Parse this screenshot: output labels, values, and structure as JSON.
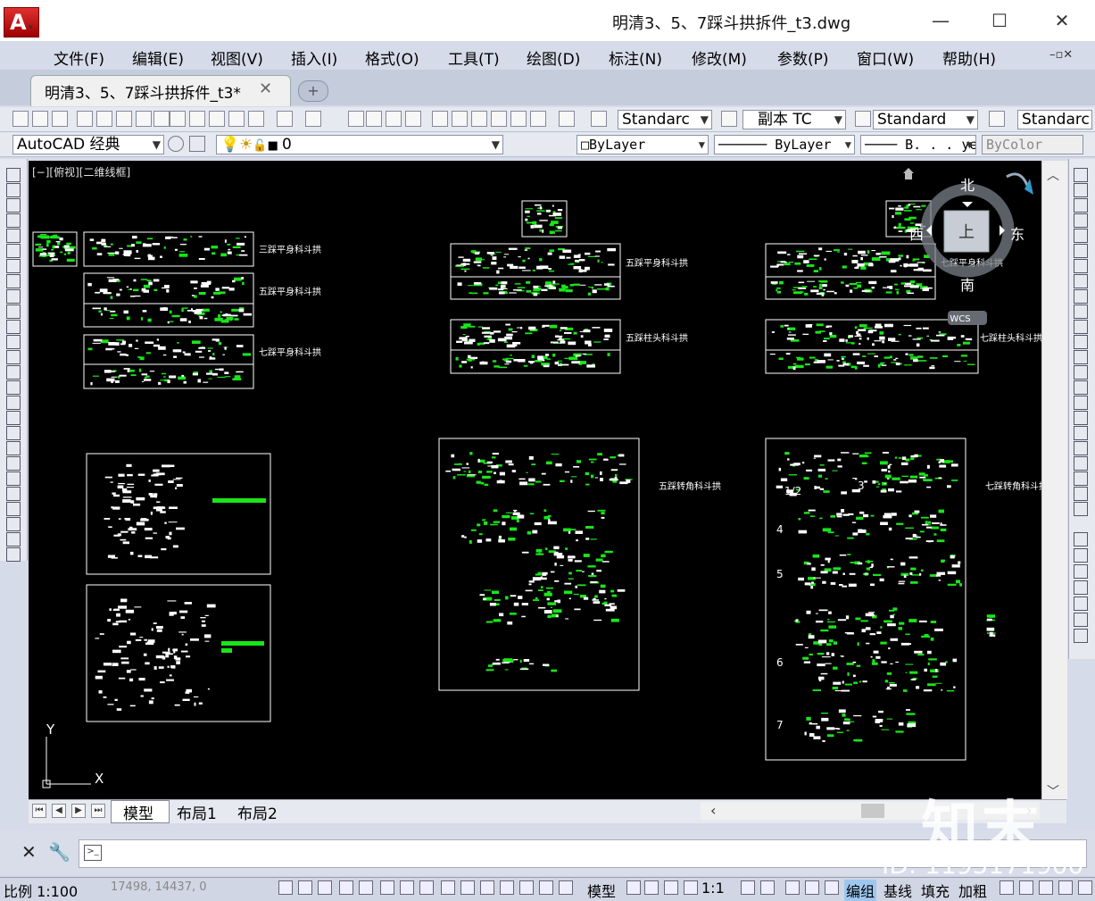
{
  "title": "明清3、5、7踩斗拱拆件_t3.dwg",
  "window_controls": {
    "minimize": "—",
    "maximize": "☐",
    "close": "✕"
  },
  "menu": [
    "文件(F)",
    "编辑(E)",
    "视图(V)",
    "插入(I)",
    "格式(O)",
    "工具(T)",
    "绘图(D)",
    "标注(N)",
    "修改(M)",
    "参数(P)",
    "窗口(W)",
    "帮助(H)"
  ],
  "doc_tab": {
    "label": "明清3、5、7踩斗拱拆件_t3*",
    "close": "✕"
  },
  "toolbar1": {
    "text_style": "Standarc",
    "annot_style": "副本  TC",
    "table_style": "Standard",
    "multileader_style": "Standarc"
  },
  "toolbar2": {
    "workspace": "AutoCAD 经典",
    "layer": "0",
    "color": "ByLayer",
    "linetype": "ByLayer",
    "lineweight": "B. . . ye",
    "plotstyle": "ByColor"
  },
  "canvas": {
    "viewport_label": "[−][俯视][二维线框]",
    "labels": {
      "l1": "三踩平身科斗拱",
      "l2": "五踩平身科斗拱",
      "l3": "七踩平身科斗拱",
      "l4": "五踩平身科斗拱",
      "l5": "五踩柱头科斗拱",
      "l6": "七踩平身科斗拱",
      "l7": "七踩柱头科斗拱",
      "l8": "五踩转角科斗拱",
      "l9": "七踩转角科斗拱"
    },
    "numbers": [
      "1/2",
      "3",
      "4",
      "5",
      "6",
      "7"
    ],
    "ucs": {
      "x": "X",
      "y": "Y"
    }
  },
  "viewcube": {
    "north": "北",
    "south": "南",
    "east": "东",
    "west": "西",
    "top": "上",
    "wcs": "WCS"
  },
  "layout_tabs": [
    "模型",
    "布局1",
    "布局2"
  ],
  "statusbar": {
    "scale": "比例  1:100",
    "coords": "17498, 14437, 0",
    "model": "模型",
    "annot_scale": "1:1",
    "items": [
      "编组",
      "基线",
      "填充",
      "加粗"
    ]
  },
  "watermark": {
    "logo": "知末",
    "id": "ID: 1195171900"
  },
  "colors": {
    "canvas": "#000000",
    "drawing_green": "#19e619",
    "drawing_white": "#ffffff",
    "chrome": "#d6dbe9"
  }
}
